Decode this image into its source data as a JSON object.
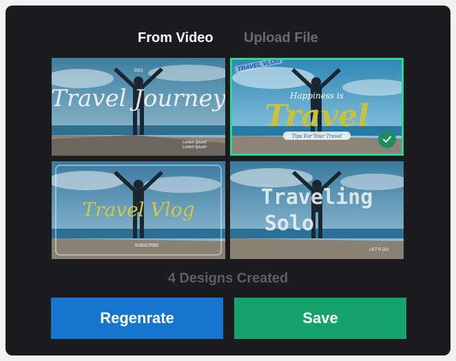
{
  "tabs": [
    {
      "label": "From Video",
      "active": true
    },
    {
      "label": "Upload File",
      "active": false
    }
  ],
  "designs": [
    {
      "title": "Travel Journey",
      "subtitle": "Lorem Ipsum\nLorem Ipsum",
      "label": "2021",
      "selected": false
    },
    {
      "kicker": "Happiness is",
      "title": "Travel",
      "tagline": "Tips For Your Travel",
      "stamp": "TRAVEL VLOG",
      "selected": true
    },
    {
      "title": "Travel Vlog",
      "caption": "SUBSCRIBE",
      "selected": false
    },
    {
      "title_line1": "Traveling",
      "title_line2": "Solo",
      "caption": "LET'S GO",
      "selected": false
    }
  ],
  "count_label": "4 Designs Created",
  "buttons": {
    "regenerate": "Regenrate",
    "save": "Save"
  },
  "colors": {
    "panel_bg": "#1c1c1e",
    "selected_border": "#2fd69a",
    "regenerate_btn": "#1676cf",
    "save_btn": "#16a26b"
  },
  "icons": {
    "selected": "check-icon"
  }
}
